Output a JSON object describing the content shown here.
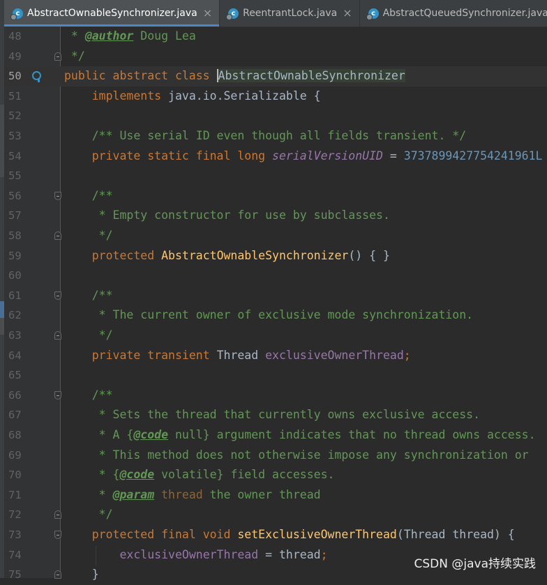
{
  "tabs": [
    {
      "label": "AbstractOwnableSynchronizer.java",
      "active": true,
      "close": "×"
    },
    {
      "label": "ReentrantLock.java",
      "active": false,
      "close": "×"
    },
    {
      "label": "AbstractQueuedSynchronizer.java",
      "active": false,
      "close": ""
    }
  ],
  "tab_icon_letter": "c",
  "lines": [
    "48",
    "49",
    "50",
    "51",
    "52",
    "53",
    "54",
    "55",
    "56",
    "57",
    "58",
    "59",
    "60",
    "61",
    "62",
    "63",
    "64",
    "65",
    "66",
    "67",
    "68",
    "69",
    "70",
    "71",
    "72",
    "73",
    "74",
    "75"
  ],
  "code": {
    "l48": {
      "a": " * ",
      "tag": "@author",
      "b": " Doug Lea"
    },
    "l49": " */",
    "l50": {
      "kw": "public abstract class ",
      "cls": "AbstractOwnableSynchronizer"
    },
    "l51": {
      "kw": "implements ",
      "rest": "java.io.Serializable {"
    },
    "l53": "/** Use serial ID even though all fields transient. */",
    "l54": {
      "kw": "private static final long ",
      "field": "serialVersionUID",
      "eq": " = ",
      "num": "3737899427754241961L"
    },
    "l56": "/**",
    "l57": " * Empty constructor for use by subclasses.",
    "l58": " */",
    "l59": {
      "kw": "protected ",
      "fn": "AbstractOwnableSynchronizer",
      "rest": "() { }"
    },
    "l61": "/**",
    "l62": " * The current owner of exclusive mode synchronization.",
    "l63": " */",
    "l64": {
      "kw": "private transient ",
      "type": "Thread ",
      "field": "exclusiveOwnerThread",
      "semi": ";"
    },
    "l66": "/**",
    "l67": " * Sets the thread that currently owns exclusive access.",
    "l68": {
      "a": " * A {",
      "tag": "@code",
      "b": " null} argument indicates that no thread owns access."
    },
    "l69": " * This method does not otherwise impose any synchronization or",
    "l70": {
      "a": " * {",
      "tag": "@code",
      "b": " volatile} field accesses."
    },
    "l71": {
      "a": " * ",
      "tag": "@param",
      "val": " thread",
      "b": " the owner thread"
    },
    "l72": " */",
    "l73": {
      "kw": "protected final void ",
      "fn": "setExclusiveOwnerThread",
      "rest": "(Thread thread) {"
    },
    "l74": {
      "field": "exclusiveOwnerThread",
      "rest": " = thread",
      "semi": ";"
    },
    "l75": "}"
  },
  "watermark": "CSDN @java持续实践",
  "colors": {
    "keyword": "#cc7832",
    "comment": "#629755",
    "field": "#9876aa",
    "number": "#6897bb",
    "function": "#ffc66d",
    "text": "#a9b7c6"
  }
}
